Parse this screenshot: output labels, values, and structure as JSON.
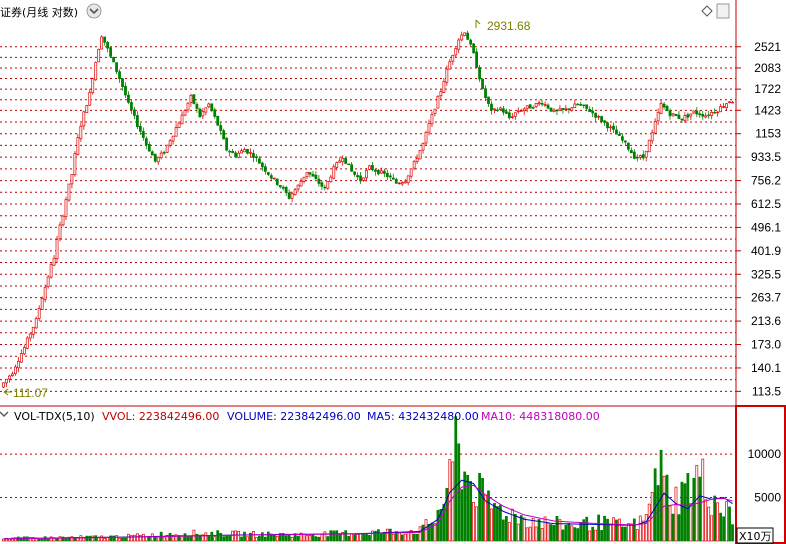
{
  "header": {
    "title": "证券(月线 对数)",
    "icons": [
      "chevron-down-icon",
      "diamond-icon"
    ]
  },
  "colors": {
    "up": "#e00000",
    "down": "#008000",
    "ma5": "#0000c0",
    "ma10": "#c000c0",
    "vol_label": "#c00000",
    "volume_label": "#0000c0",
    "ma5_label": "#0000c0",
    "ma10_label": "#c000c0",
    "grid": "#c00000",
    "border": "#d00000",
    "annotation": "#808000"
  },
  "price_chart": {
    "high_annotation": "2931.68",
    "low_annotation": "111.07",
    "y_ticks": [
      "2521",
      "2083",
      "1722",
      "1423",
      "1153",
      "933.5",
      "756.2",
      "612.5",
      "496.1",
      "401.9",
      "325.5",
      "263.7",
      "213.6",
      "173.0",
      "140.1",
      "113.5"
    ]
  },
  "volume_panel": {
    "indicator": "VOL-TDX(5,10)",
    "vvol": "VVOL: 223842496.00",
    "volume": "VOLUME: 223842496.00",
    "ma5": "MA5: 432432480.00",
    "ma10": "MA10: 448318080.00",
    "y_ticks": [
      "10000",
      "5000"
    ],
    "unit": "X10万"
  },
  "chart_data": {
    "type": "candlestick",
    "title": "证券(月线 对数)",
    "scale": "log",
    "ylim": [
      105,
      3150
    ],
    "high": 2931.68,
    "low": 111.07,
    "price_path": [
      [
        0,
        118
      ],
      [
        4,
        135
      ],
      [
        8,
        168
      ],
      [
        12,
        215
      ],
      [
        15,
        290
      ],
      [
        18,
        380
      ],
      [
        21,
        560
      ],
      [
        24,
        800
      ],
      [
        27,
        1250
      ],
      [
        30,
        1650
      ],
      [
        32,
        2200
      ],
      [
        34,
        2800
      ],
      [
        37,
        2300
      ],
      [
        40,
        1900
      ],
      [
        43,
        1500
      ],
      [
        46,
        1250
      ],
      [
        49,
        1050
      ],
      [
        52,
        900
      ],
      [
        55,
        980
      ],
      [
        58,
        1150
      ],
      [
        61,
        1350
      ],
      [
        64,
        1600
      ],
      [
        67,
        1350
      ],
      [
        70,
        1500
      ],
      [
        73,
        1250
      ],
      [
        76,
        1000
      ],
      [
        79,
        950
      ],
      [
        82,
        1000
      ],
      [
        85,
        950
      ],
      [
        88,
        860
      ],
      [
        91,
        780
      ],
      [
        94,
        720
      ],
      [
        97,
        650
      ],
      [
        100,
        720
      ],
      [
        103,
        820
      ],
      [
        106,
        760
      ],
      [
        109,
        700
      ],
      [
        112,
        840
      ],
      [
        115,
        940
      ],
      [
        118,
        820
      ],
      [
        121,
        760
      ],
      [
        124,
        850
      ],
      [
        127,
        820
      ],
      [
        130,
        790
      ],
      [
        133,
        740
      ],
      [
        136,
        760
      ],
      [
        139,
        880
      ],
      [
        142,
        1050
      ],
      [
        145,
        1350
      ],
      [
        148,
        1700
      ],
      [
        151,
        2200
      ],
      [
        154,
        2700
      ],
      [
        156,
        2900
      ],
      [
        159,
        2350
      ],
      [
        162,
        1700
      ],
      [
        165,
        1400
      ],
      [
        168,
        1450
      ],
      [
        171,
        1330
      ],
      [
        174,
        1420
      ],
      [
        178,
        1470
      ],
      [
        182,
        1530
      ],
      [
        186,
        1400
      ],
      [
        190,
        1430
      ],
      [
        194,
        1500
      ],
      [
        198,
        1420
      ],
      [
        202,
        1300
      ],
      [
        206,
        1180
      ],
      [
        210,
        1050
      ],
      [
        213,
        940
      ],
      [
        216,
        930
      ],
      [
        219,
        1150
      ],
      [
        222,
        1500
      ],
      [
        225,
        1380
      ],
      [
        229,
        1320
      ],
      [
        233,
        1400
      ],
      [
        237,
        1360
      ],
      [
        241,
        1430
      ],
      [
        245,
        1550
      ]
    ],
    "volume_path": [
      [
        0,
        300
      ],
      [
        40,
        500
      ],
      [
        60,
        900
      ],
      [
        100,
        700
      ],
      [
        140,
        1200
      ],
      [
        145,
        2500
      ],
      [
        150,
        6500
      ],
      [
        152,
        11500
      ],
      [
        155,
        7800
      ],
      [
        158,
        6500
      ],
      [
        162,
        4500
      ],
      [
        166,
        3800
      ],
      [
        170,
        3200
      ],
      [
        175,
        2600
      ],
      [
        180,
        2200
      ],
      [
        190,
        1800
      ],
      [
        200,
        2100
      ],
      [
        210,
        1700
      ],
      [
        215,
        2200
      ],
      [
        218,
        4500
      ],
      [
        219,
        10500
      ],
      [
        222,
        6500
      ],
      [
        226,
        4800
      ],
      [
        230,
        6200
      ],
      [
        234,
        7500
      ],
      [
        238,
        5000
      ],
      [
        243,
        3500
      ],
      [
        245,
        2200
      ]
    ],
    "ma5_path": [
      [
        0,
        250
      ],
      [
        40,
        450
      ],
      [
        80,
        700
      ],
      [
        120,
        850
      ],
      [
        140,
        1100
      ],
      [
        146,
        2500
      ],
      [
        150,
        5600
      ],
      [
        154,
        7000
      ],
      [
        158,
        6600
      ],
      [
        162,
        4600
      ],
      [
        168,
        3400
      ],
      [
        175,
        2500
      ],
      [
        185,
        2000
      ],
      [
        200,
        1900
      ],
      [
        212,
        1800
      ],
      [
        216,
        2200
      ],
      [
        219,
        3800
      ],
      [
        222,
        5500
      ],
      [
        226,
        4300
      ],
      [
        230,
        3700
      ],
      [
        234,
        5200
      ],
      [
        238,
        4800
      ],
      [
        242,
        5000
      ],
      [
        245,
        4300
      ]
    ],
    "ma10_path": [
      [
        0,
        240
      ],
      [
        40,
        430
      ],
      [
        80,
        680
      ],
      [
        120,
        820
      ],
      [
        140,
        1000
      ],
      [
        146,
        2000
      ],
      [
        150,
        4600
      ],
      [
        154,
        6200
      ],
      [
        158,
        6400
      ],
      [
        162,
        5300
      ],
      [
        168,
        4000
      ],
      [
        175,
        3000
      ],
      [
        185,
        2300
      ],
      [
        200,
        2000
      ],
      [
        212,
        1850
      ],
      [
        216,
        2000
      ],
      [
        219,
        3000
      ],
      [
        222,
        4000
      ],
      [
        226,
        4200
      ],
      [
        230,
        4100
      ],
      [
        234,
        4400
      ],
      [
        238,
        4800
      ],
      [
        242,
        4900
      ],
      [
        245,
        4600
      ]
    ],
    "volume_ylim": [
      0,
      13000
    ]
  }
}
